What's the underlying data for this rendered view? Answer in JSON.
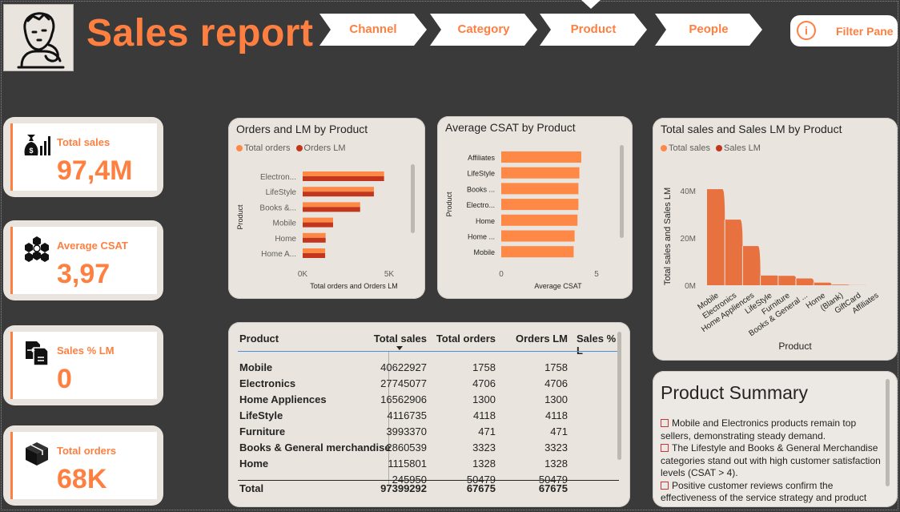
{
  "header": {
    "title": "Sales report",
    "nav": [
      "Channel",
      "Category",
      "Product",
      "People"
    ],
    "active_nav": "Product",
    "filter_pane": "Filter Pane"
  },
  "kpis": [
    {
      "label": "Total sales",
      "value": "97,4M",
      "icon": "money-bag-chart-icon"
    },
    {
      "label": "Average CSAT",
      "value": "3,97",
      "icon": "network-hexagon-icon"
    },
    {
      "label": "Sales % LM",
      "value": "0",
      "icon": "document-transfer-icon"
    },
    {
      "label": "Total orders",
      "value": "68K",
      "icon": "package-box-icon"
    }
  ],
  "colors": {
    "accent": "#fe7f3f",
    "series_light": "#fe8845",
    "series_dark": "#c1361c",
    "card_bg": "#e9e4de",
    "page_bg": "#3a3a3a"
  },
  "chart_data": [
    {
      "type": "bar",
      "orientation": "horizontal",
      "title": "Orders and LM by Product",
      "xlabel": "Total orders and Orders LM",
      "ylabel": "Product",
      "categories": [
        "Electron...",
        "LifeStyle",
        "Books &...",
        "Mobile",
        "Home",
        "Home A..."
      ],
      "series": [
        {
          "name": "Total orders",
          "values": [
            4706,
            4118,
            3323,
            1758,
            1328,
            1300
          ]
        },
        {
          "name": "Orders LM",
          "values": [
            4706,
            4118,
            3323,
            1758,
            1328,
            1300
          ]
        }
      ],
      "xticks": [
        "0K",
        "5K"
      ],
      "xlim": [
        0,
        5000
      ]
    },
    {
      "type": "bar",
      "orientation": "horizontal",
      "title": "Average CSAT by Product",
      "xlabel": "Average CSAT",
      "ylabel": "Product",
      "categories": [
        "Affiliates",
        "LifeStyle",
        "Books ...",
        "Electro...",
        "Home",
        "Home ...",
        "Mobile"
      ],
      "values": [
        4.2,
        4.1,
        4.05,
        4.05,
        4.0,
        3.85,
        3.8
      ],
      "xticks": [
        "0",
        "5"
      ],
      "xlim": [
        0,
        5
      ]
    },
    {
      "type": "area",
      "title": "Total sales and Sales LM by Product",
      "xlabel": "Product",
      "ylabel": "Total sales and Sales LM",
      "categories": [
        "Mobile",
        "Electronics",
        "Home Appliences",
        "LifeStyle",
        "Furniture",
        "Books & General ...",
        "Home",
        "(Blank)",
        "GiftCard",
        "Affiliates"
      ],
      "series": [
        {
          "name": "Total sales",
          "values": [
            40622927,
            27745077,
            16562906,
            4116735,
            3993370,
            2860539,
            1115801,
            245950,
            60000,
            20000
          ]
        },
        {
          "name": "Sales LM",
          "values": [
            40622927,
            27745077,
            16562906,
            4116735,
            3993370,
            2860539,
            1115801,
            245950,
            60000,
            20000
          ]
        }
      ],
      "yticks": [
        "0M",
        "20M",
        "40M"
      ],
      "ylim": [
        0,
        45000000
      ]
    }
  ],
  "table": {
    "headers": [
      "Product",
      "Total sales",
      "Total orders",
      "Orders LM",
      "Sales % L"
    ],
    "rows": [
      [
        "Mobile",
        "40622927",
        "1758",
        "1758",
        ""
      ],
      [
        "Electronics",
        "27745077",
        "4706",
        "4706",
        ""
      ],
      [
        "Home Appliences",
        "16562906",
        "1300",
        "1300",
        ""
      ],
      [
        "LifeStyle",
        "4116735",
        "4118",
        "4118",
        ""
      ],
      [
        "Furniture",
        "3993370",
        "471",
        "471",
        ""
      ],
      [
        "Books & General merchandise",
        "2860539",
        "3323",
        "3323",
        ""
      ],
      [
        "Home",
        "1115801",
        "1328",
        "1328",
        ""
      ],
      [
        "",
        "245950",
        "50479",
        "50479",
        ""
      ]
    ],
    "total": [
      "Total",
      "97399292",
      "67675",
      "67675",
      ""
    ]
  },
  "summary": {
    "title": "Product Summary",
    "points": [
      "Mobile and Electronics products remain top sellers, demonstrating steady demand.",
      "The Lifestyle and Books & General Merchandise categories stand out with high customer satisfaction levels (CSAT > 4).",
      "Positive customer reviews confirm the effectiveness of the service strategy and product"
    ]
  }
}
